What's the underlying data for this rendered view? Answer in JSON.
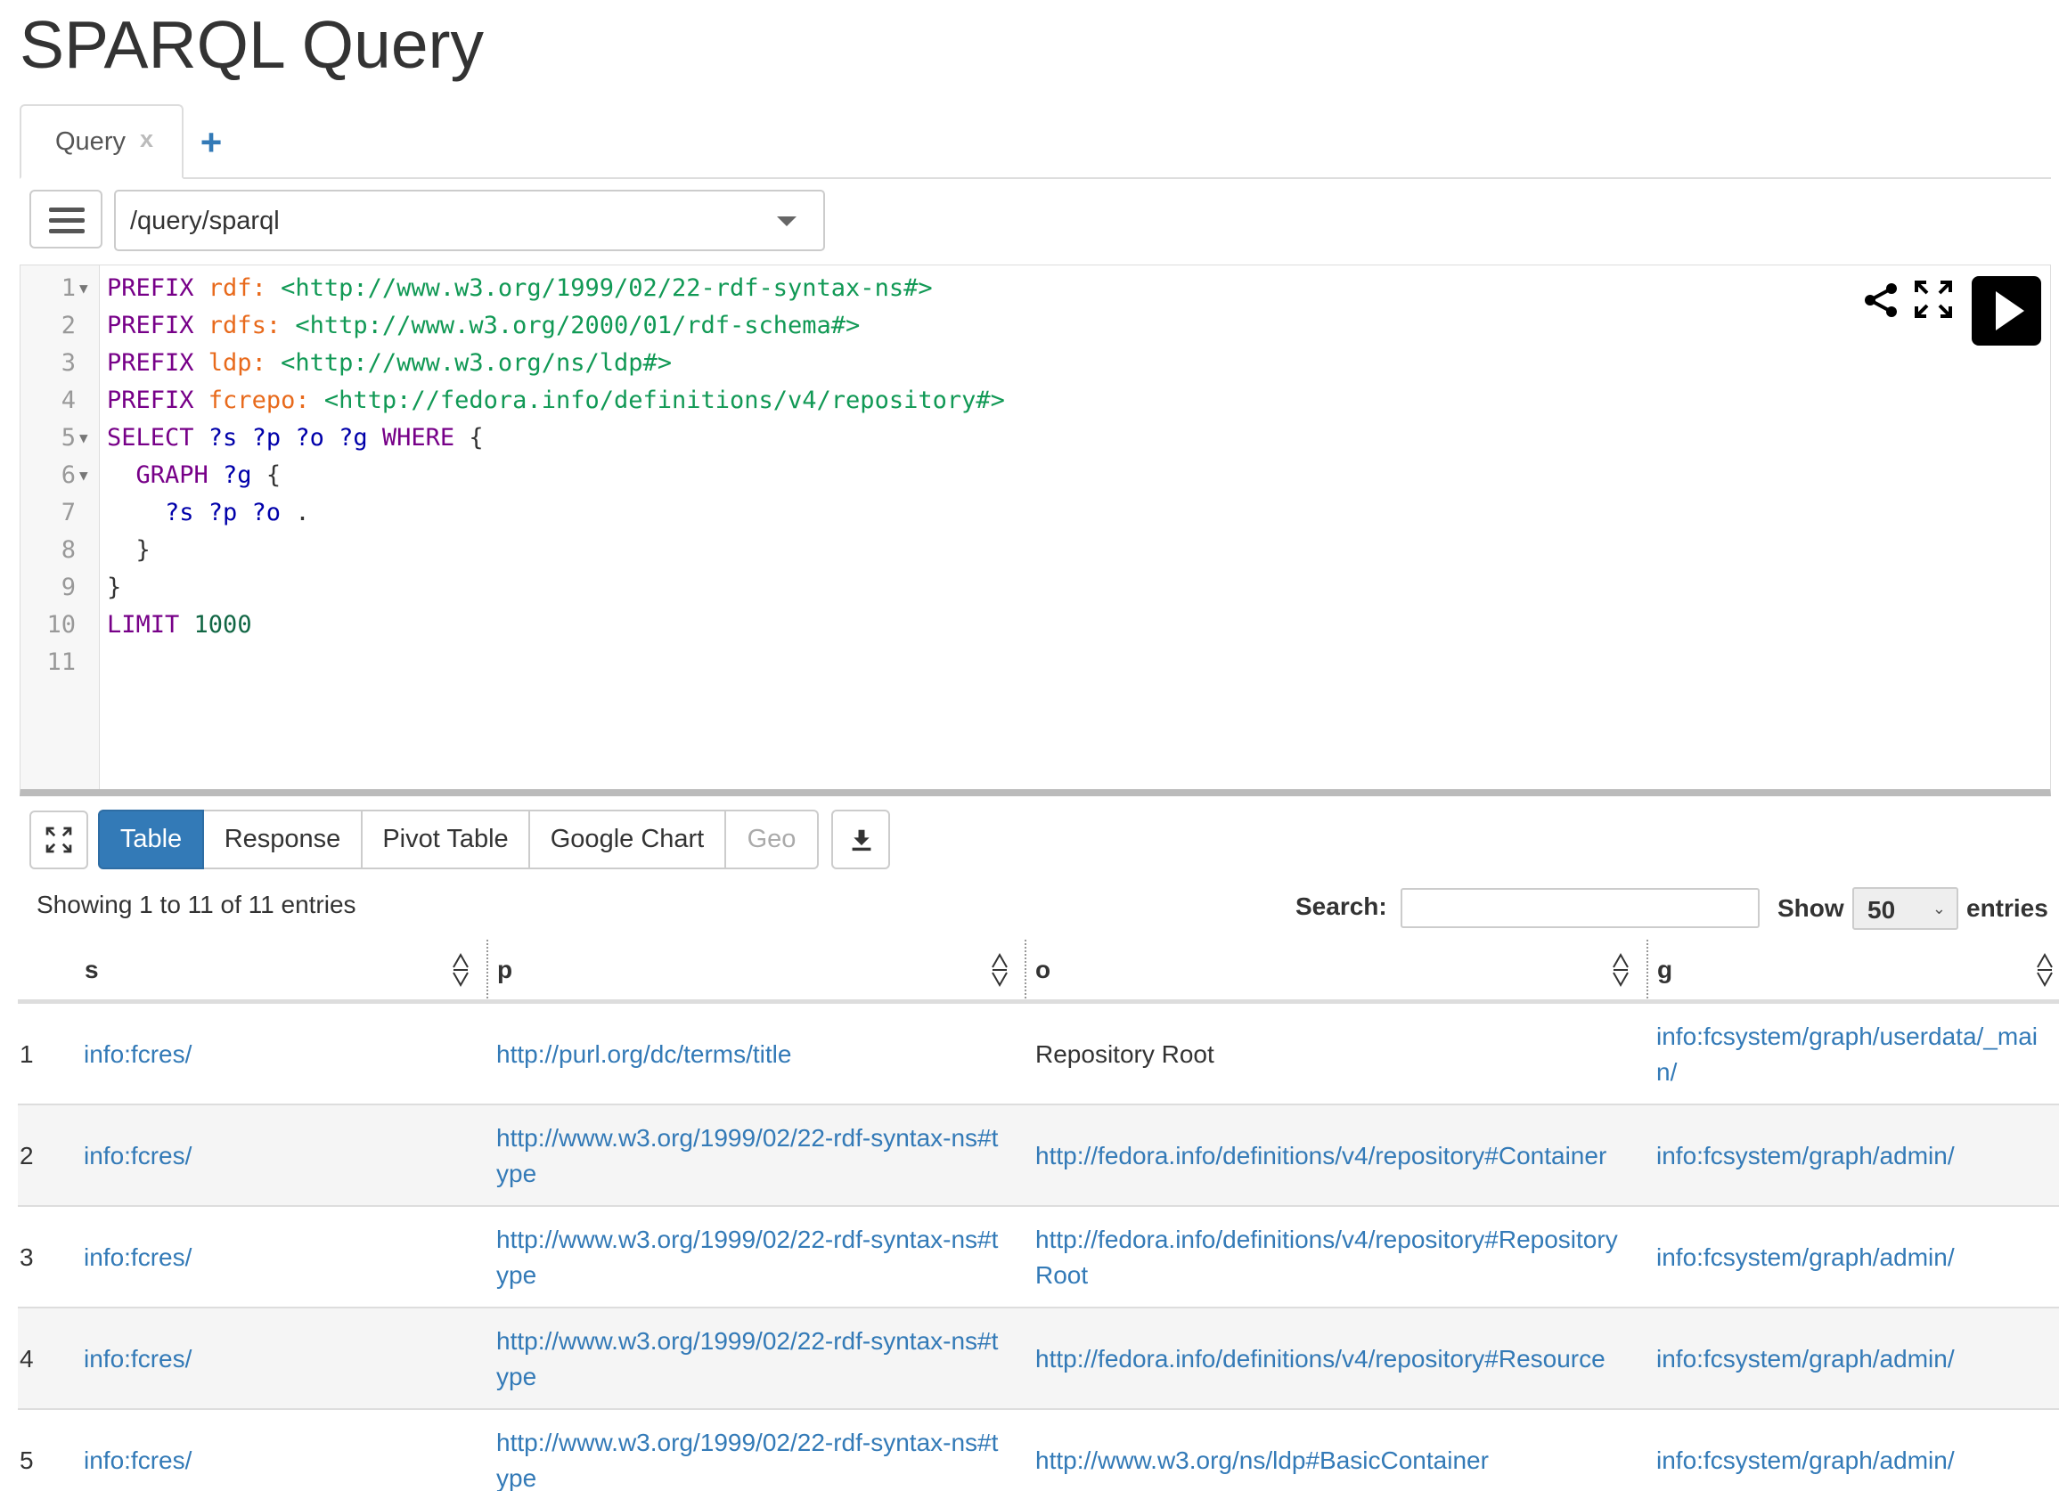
{
  "page_title": "SPARQL Query",
  "tabs": [
    {
      "label": "Query",
      "close": "x"
    }
  ],
  "tab_add": "+",
  "endpoint": "/query/sparql",
  "editor": {
    "lines": [
      {
        "n": "1",
        "fold": "▼",
        "tokens": [
          {
            "t": "PREFIX ",
            "c": "kw"
          },
          {
            "t": "rdf:",
            "c": "pfx"
          },
          {
            "t": " ",
            "c": "pun"
          },
          {
            "t": "<http://www.w3.org/1999/02/22-rdf-syntax-ns#>",
            "c": "iri"
          }
        ]
      },
      {
        "n": "2",
        "fold": "",
        "tokens": [
          {
            "t": "PREFIX ",
            "c": "kw"
          },
          {
            "t": "rdfs:",
            "c": "pfx"
          },
          {
            "t": " ",
            "c": "pun"
          },
          {
            "t": "<http://www.w3.org/2000/01/rdf-schema#>",
            "c": "iri"
          }
        ]
      },
      {
        "n": "3",
        "fold": "",
        "tokens": [
          {
            "t": "PREFIX ",
            "c": "kw"
          },
          {
            "t": "ldp:",
            "c": "pfx"
          },
          {
            "t": " ",
            "c": "pun"
          },
          {
            "t": "<http://www.w3.org/ns/ldp#>",
            "c": "iri"
          }
        ]
      },
      {
        "n": "4",
        "fold": "",
        "tokens": [
          {
            "t": "PREFIX ",
            "c": "kw"
          },
          {
            "t": "fcrepo:",
            "c": "pfx"
          },
          {
            "t": " ",
            "c": "pun"
          },
          {
            "t": "<http://fedora.info/definitions/v4/repository#>",
            "c": "iri"
          }
        ]
      },
      {
        "n": "5",
        "fold": "▼",
        "tokens": [
          {
            "t": "SELECT ",
            "c": "kw"
          },
          {
            "t": "?s ?p ?o ?g ",
            "c": "var"
          },
          {
            "t": "WHERE",
            "c": "kw"
          },
          {
            "t": " {",
            "c": "pun"
          }
        ]
      },
      {
        "n": "6",
        "fold": "▼",
        "tokens": [
          {
            "t": "  GRAPH ",
            "c": "kw"
          },
          {
            "t": "?g",
            "c": "var"
          },
          {
            "t": " {",
            "c": "pun"
          }
        ]
      },
      {
        "n": "7",
        "fold": "",
        "tokens": [
          {
            "t": "    ?s ?p ?o",
            "c": "var"
          },
          {
            "t": " .",
            "c": "pun"
          }
        ]
      },
      {
        "n": "8",
        "fold": "",
        "tokens": [
          {
            "t": "  }",
            "c": "pun"
          }
        ]
      },
      {
        "n": "9",
        "fold": "",
        "tokens": [
          {
            "t": "}",
            "c": "pun"
          }
        ]
      },
      {
        "n": "10",
        "fold": "",
        "tokens": [
          {
            "t": "LIMIT ",
            "c": "kw"
          },
          {
            "t": "1000",
            "c": "num"
          }
        ]
      },
      {
        "n": "11",
        "fold": "",
        "tokens": []
      }
    ]
  },
  "view_buttons": [
    {
      "label": "Table",
      "state": "active"
    },
    {
      "label": "Response",
      "state": "normal"
    },
    {
      "label": "Pivot Table",
      "state": "normal"
    },
    {
      "label": "Google Chart",
      "state": "normal"
    },
    {
      "label": "Geo",
      "state": "disabled"
    }
  ],
  "info_text": "Showing 1 to 11 of 11 entries",
  "search_label": "Search:",
  "search_value": "",
  "show_label": "Show",
  "length_value": "50",
  "entries_label": "entries",
  "columns": [
    "s",
    "p",
    "o",
    "g"
  ],
  "rows": [
    {
      "num": "1",
      "s": [
        "info:fcres/"
      ],
      "p": [
        "http://purl.org/dc/terms/title"
      ],
      "o": [
        "Repository Root"
      ],
      "o_link": false,
      "g": [
        "info:fcsystem/graph/userdata/_mai",
        "n/"
      ]
    },
    {
      "num": "2",
      "s": [
        "info:fcres/"
      ],
      "p": [
        "http://www.w3.org/1999/02/22-rdf-syntax-ns#t",
        "ype"
      ],
      "o": [
        "http://fedora.info/definitions/v4/repository#Container"
      ],
      "o_link": true,
      "g": [
        "info:fcsystem/graph/admin/"
      ]
    },
    {
      "num": "3",
      "s": [
        "info:fcres/"
      ],
      "p": [
        "http://www.w3.org/1999/02/22-rdf-syntax-ns#t",
        "ype"
      ],
      "o": [
        "http://fedora.info/definitions/v4/repository#Repository",
        "Root"
      ],
      "o_link": true,
      "g": [
        "info:fcsystem/graph/admin/"
      ]
    },
    {
      "num": "4",
      "s": [
        "info:fcres/"
      ],
      "p": [
        "http://www.w3.org/1999/02/22-rdf-syntax-ns#t",
        "ype"
      ],
      "o": [
        "http://fedora.info/definitions/v4/repository#Resource"
      ],
      "o_link": true,
      "g": [
        "info:fcsystem/graph/admin/"
      ]
    },
    {
      "num": "5",
      "s": [
        "info:fcres/"
      ],
      "p": [
        "http://www.w3.org/1999/02/22-rdf-syntax-ns#t",
        "ype"
      ],
      "o": [
        "http://www.w3.org/ns/ldp#BasicContainer"
      ],
      "o_link": true,
      "g": [
        "info:fcsystem/graph/admin/"
      ]
    }
  ],
  "colors": {
    "link": "#337ab7",
    "active": "#337ab7",
    "keyword": "#770088",
    "prefix": "#e86a1c",
    "iri": "#119955",
    "variable": "#0000aa"
  }
}
